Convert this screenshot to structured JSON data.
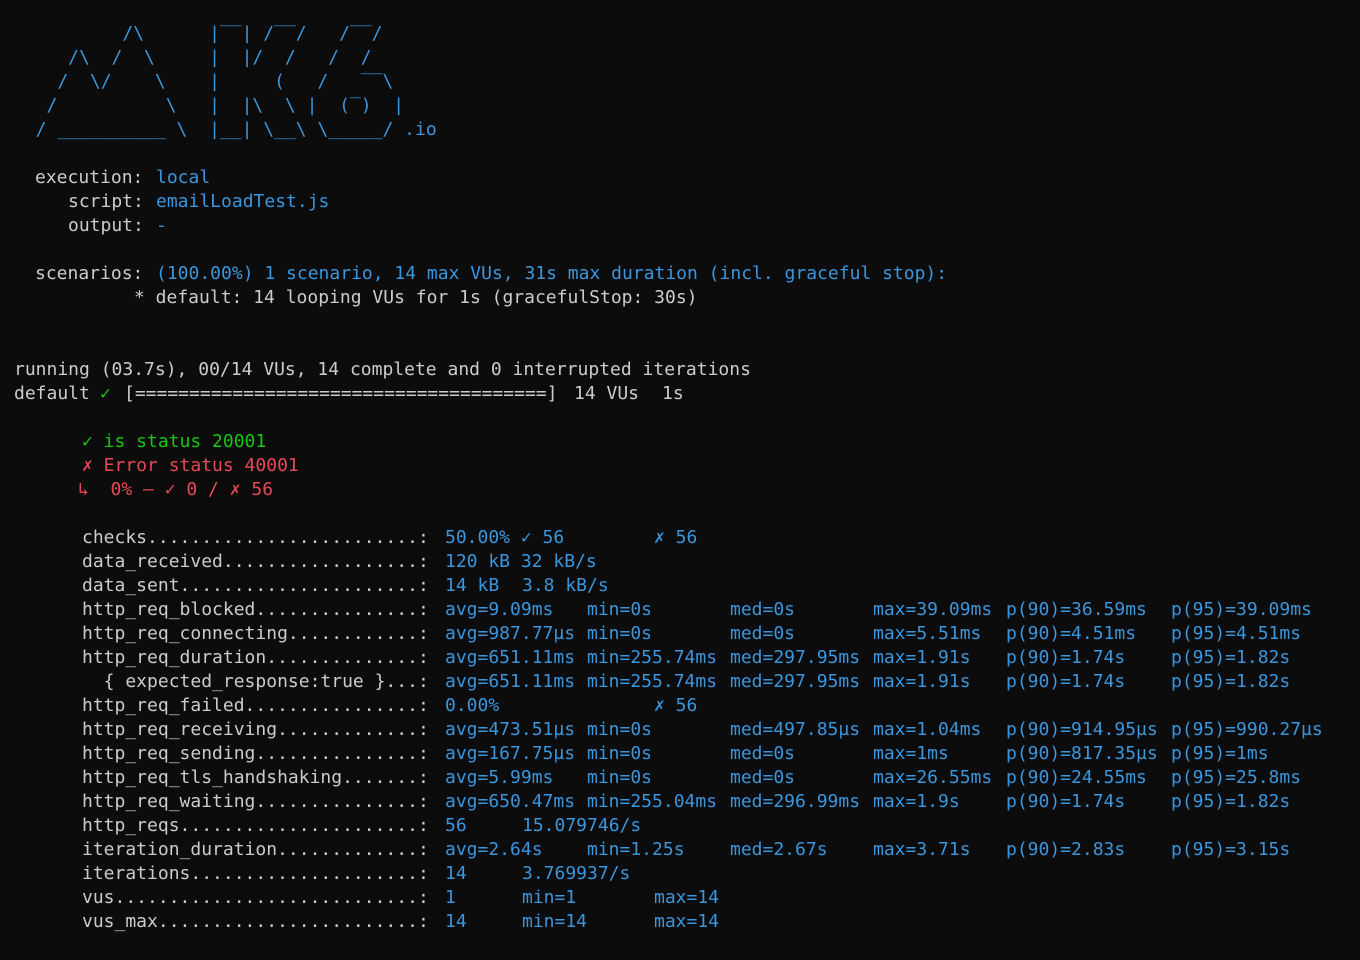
{
  "logo": {
    "ascii": "          /\\      |‾‾| /‾‾/   /‾‾/\n     /\\  /  \\     |  |/  /   /  /\n    /  \\/    \\    |     (   /   ‾‾\\\n   /          \\   |  |\\  \\ |  (‾)  |\n  / __________ \\  |__| \\__\\ \\_____/",
    "suffix": ".io"
  },
  "header": {
    "execution_label": "execution:",
    "execution": "local",
    "script_label": "script:",
    "script": "emailLoadTest.js",
    "output_label": "output:",
    "output": "-",
    "scenarios_label": "scenarios:",
    "scenarios": "(100.00%) 1 scenario, 14 max VUs, 31s max duration (incl. graceful stop):",
    "scenario_detail": "* default: 14 looping VUs for 1s (gracefulStop: 30s)"
  },
  "progress": {
    "running": "running (03.7s), 00/14 VUs, 14 complete and 0 interrupted iterations",
    "name": "default",
    "check": "✓",
    "bar": "[======================================]",
    "vus": "14 VUs",
    "dur": "1s"
  },
  "checks": {
    "pass": "✓ is status 20001",
    "fail": "✗ Error status 40001",
    "fail_detail": "↳  0% — ✓ 0 / ✗ 56"
  },
  "metrics": [
    {
      "name": "checks.........................:",
      "c1": "50.00% ✓ 56",
      "c4": "✗ 56"
    },
    {
      "name": "data_received..................:",
      "c1": "120 kB 32 kB/s"
    },
    {
      "name": "data_sent......................:",
      "c1": "14 kB",
      "c2": "3.8 kB/s"
    },
    {
      "name": "http_req_blocked...............:",
      "c1": "avg=9.09ms",
      "c3": "min=0s",
      "c5": "med=0s",
      "c6": "max=39.09ms",
      "c7": "p(90)=36.59ms",
      "c8": "p(95)=39.09ms"
    },
    {
      "name": "http_req_connecting............:",
      "c1": "avg=987.77µs",
      "c3": "min=0s",
      "c5": "med=0s",
      "c6": "max=5.51ms",
      "c7": "p(90)=4.51ms",
      "c8": "p(95)=4.51ms"
    },
    {
      "name": "http_req_duration..............:",
      "c1": "avg=651.11ms",
      "c3": "min=255.74ms",
      "c5": "med=297.95ms",
      "c6": "max=1.91s",
      "c7": "p(90)=1.74s",
      "c8": "p(95)=1.82s"
    },
    {
      "name": "  { expected_response:true }...:",
      "c1": "avg=651.11ms",
      "c3": "min=255.74ms",
      "c5": "med=297.95ms",
      "c6": "max=1.91s",
      "c7": "p(90)=1.74s",
      "c8": "p(95)=1.82s"
    },
    {
      "name": "http_req_failed................:",
      "c1": "0.00%",
      "c4": "✗ 56"
    },
    {
      "name": "http_req_receiving.............:",
      "c1": "avg=473.51µs",
      "c3": "min=0s",
      "c5": "med=497.85µs",
      "c6": "max=1.04ms",
      "c7": "p(90)=914.95µs",
      "c8": "p(95)=990.27µs"
    },
    {
      "name": "http_req_sending...............:",
      "c1": "avg=167.75µs",
      "c3": "min=0s",
      "c5": "med=0s",
      "c6": "max=1ms",
      "c7": "p(90)=817.35µs",
      "c8": "p(95)=1ms"
    },
    {
      "name": "http_req_tls_handshaking.......:",
      "c1": "avg=5.99ms",
      "c3": "min=0s",
      "c5": "med=0s",
      "c6": "max=26.55ms",
      "c7": "p(90)=24.55ms",
      "c8": "p(95)=25.8ms"
    },
    {
      "name": "http_req_waiting...............:",
      "c1": "avg=650.47ms",
      "c3": "min=255.04ms",
      "c5": "med=296.99ms",
      "c6": "max=1.9s",
      "c7": "p(90)=1.74s",
      "c8": "p(95)=1.82s"
    },
    {
      "name": "http_reqs......................:",
      "c1": "56",
      "c2": "15.079746/s"
    },
    {
      "name": "iteration_duration.............:",
      "c1": "avg=2.64s",
      "c3": "min=1.25s",
      "c5": "med=2.67s",
      "c6": "max=3.71s",
      "c7": "p(90)=2.83s",
      "c8": "p(95)=3.15s"
    },
    {
      "name": "iterations.....................:",
      "c1": "14",
      "c2": "3.769937/s"
    },
    {
      "name": "vus............................:",
      "c1": "1",
      "c2": "min=1",
      "c4": "max=14"
    },
    {
      "name": "vus_max........................:",
      "c1": "14",
      "c2": "min=14",
      "c4": "max=14"
    }
  ]
}
